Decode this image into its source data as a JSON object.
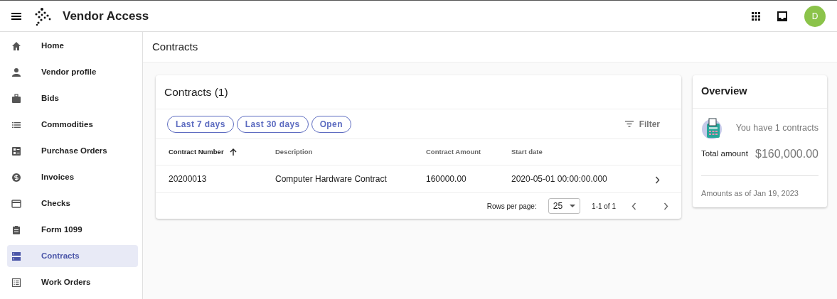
{
  "app": {
    "title": "Vendor Access",
    "avatar": "D"
  },
  "sidebar": {
    "items": [
      {
        "label": "Home",
        "selected": false
      },
      {
        "label": "Vendor profile",
        "selected": false
      },
      {
        "label": "Bids",
        "selected": false
      },
      {
        "label": "Commodities",
        "selected": false
      },
      {
        "label": "Purchase Orders",
        "selected": false
      },
      {
        "label": "Invoices",
        "selected": false
      },
      {
        "label": "Checks",
        "selected": false
      },
      {
        "label": "Form 1099",
        "selected": false
      },
      {
        "label": "Contracts",
        "selected": true
      },
      {
        "label": "Work Orders",
        "selected": false
      }
    ]
  },
  "page_title": "Contracts",
  "contracts_card": {
    "title": "Contracts (1)",
    "chips": [
      "Last 7 days",
      "Last 30 days",
      "Open"
    ],
    "filter": "Filter",
    "table": {
      "columns": [
        {
          "label": "Contract Number",
          "sorted": true
        },
        {
          "label": "Description",
          "sorted": false
        },
        {
          "label": "Contract Amount",
          "sorted": false
        },
        {
          "label": "Start date",
          "sorted": false
        }
      ],
      "rows": [
        [
          "20200013",
          "Computer Hardware Contract",
          "160000.00",
          "2020-05-01 00:00:00.000"
        ]
      ]
    },
    "pagination": {
      "rows_per_page_label": "Rows per page:",
      "rows_per_page": "25",
      "range": "1-1 of 1"
    }
  },
  "overview": {
    "title": "Overview",
    "summary": "You have 1 contracts",
    "total_label": "Total amount",
    "total": "$160,000.00",
    "note": "Amounts as of Jan 19, 2023"
  }
}
